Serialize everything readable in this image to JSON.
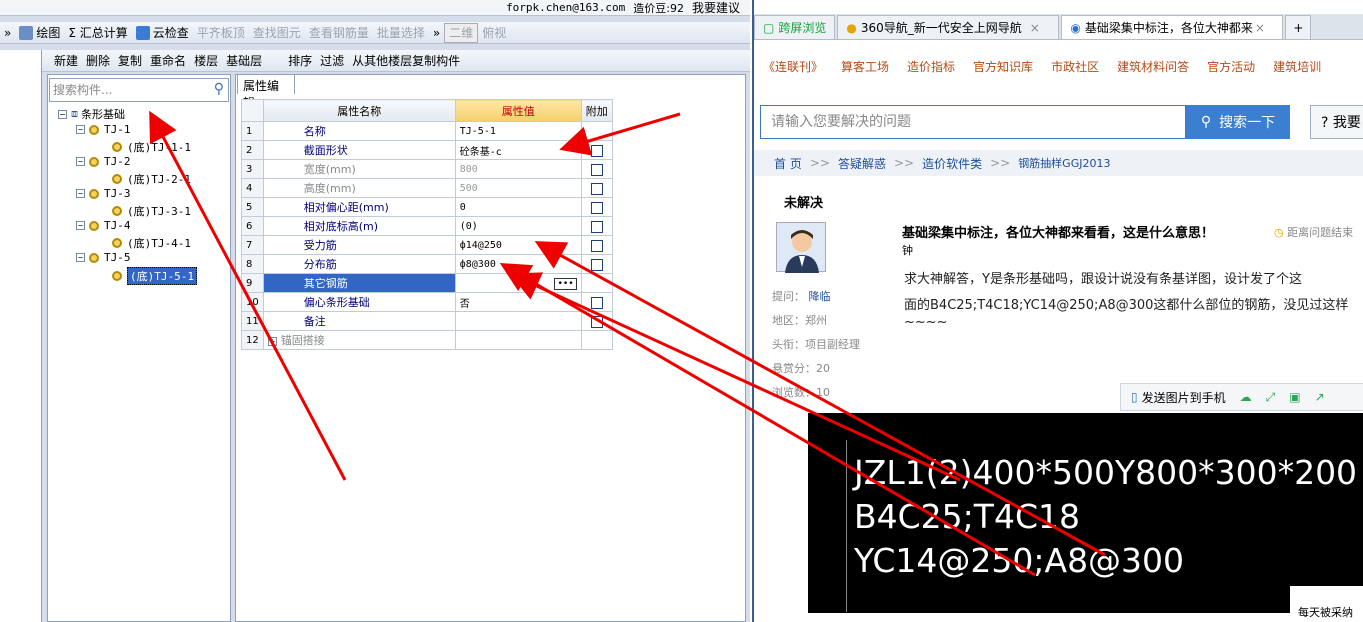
{
  "app": {
    "topbar": {
      "user": "forpk.chen@163.com",
      "beans": "造价豆:92",
      "suggest": "我要建议"
    },
    "toolbar1": [
      "绘图",
      "Σ 汇总计算",
      "云检查",
      "平齐板顶",
      "查找图元",
      "查看钢筋量",
      "批量选择",
      "二维",
      "俯视"
    ],
    "toolbar2": [
      "新建",
      "删除",
      "复制",
      "重命名",
      "楼层",
      "基础层",
      "排序",
      "过滤",
      "从其他楼层复制构件"
    ],
    "search_placeholder": "搜索构件...",
    "tree": {
      "root": "条形基础",
      "items": [
        {
          "name": "TJ-1",
          "child": "(底)TJ-1-1"
        },
        {
          "name": "TJ-2",
          "child": "(底)TJ-2-1"
        },
        {
          "name": "TJ-3",
          "child": "(底)TJ-3-1"
        },
        {
          "name": "TJ-4",
          "child": "(底)TJ-4-1"
        },
        {
          "name": "TJ-5",
          "child": "(底)TJ-5-1"
        }
      ]
    },
    "props_tab": "属性编辑",
    "props_header": {
      "name": "属性名称",
      "value": "属性值",
      "extra": "附加"
    },
    "props": [
      {
        "n": "1",
        "name": "名称",
        "value": "TJ-5-1"
      },
      {
        "n": "2",
        "name": "截面形状",
        "value": "砼条基-c"
      },
      {
        "n": "3",
        "name": "宽度(mm)",
        "value": "800"
      },
      {
        "n": "4",
        "name": "高度(mm)",
        "value": "500"
      },
      {
        "n": "5",
        "name": "相对偏心距(mm)",
        "value": "0"
      },
      {
        "n": "6",
        "name": "相对底标高(m)",
        "value": "(0)"
      },
      {
        "n": "7",
        "name": "受力筋",
        "value": "ф14@250"
      },
      {
        "n": "8",
        "name": "分布筋",
        "value": "ф8@300"
      },
      {
        "n": "9",
        "name": "其它钢筋",
        "value": ""
      },
      {
        "n": "10",
        "name": "偏心条形基础",
        "value": "否"
      },
      {
        "n": "11",
        "name": "备注",
        "value": ""
      },
      {
        "n": "12",
        "name": "锚固搭接",
        "value": ""
      }
    ]
  },
  "browser": {
    "tabs": [
      "跨屏浏览",
      "360导航_新一代安全上网导航",
      "基础梁集中标注，各位大神都来"
    ],
    "nav": [
      "《连联刊》",
      "算客工场",
      "造价指标",
      "官方知识库",
      "市政社区",
      "建筑材料问答",
      "官方活动",
      "建筑培训"
    ],
    "search_placeholder": "请输入您要解决的问题",
    "search_btn": "搜索一下",
    "ask_btn": "? 我要",
    "crumb": [
      "首 页",
      "答疑解惑",
      "造价软件类",
      "钢筋抽样GGJ2013"
    ],
    "status": "未解决",
    "asker_label": "提问：",
    "asker": "降临",
    "region": "地区：郑州",
    "title_label": "头衔：项目副经理",
    "reward": "悬赏分：20",
    "views": "浏览数：10",
    "q_title": "基础梁集中标注，各位大神都来看看，这是什么意思！",
    "q_time": "距离问题结束",
    "q_time2": "钟",
    "body1": "求大神解答，Y是条形基础吗，跟设计说没有条基详图，设计发了个这",
    "body2": "面的B4C25;T4C18;YC14@250;A8@300这都什么部位的钢筋，没见过这样",
    "body3": "~~~~",
    "send_to_phone": "发送图片到手机",
    "cad": [
      "JZL1(2)400*500Y800*300*200",
      "B4C25;T4C18",
      "YC14@250;A8@300"
    ],
    "daily": "每天被采纳"
  }
}
